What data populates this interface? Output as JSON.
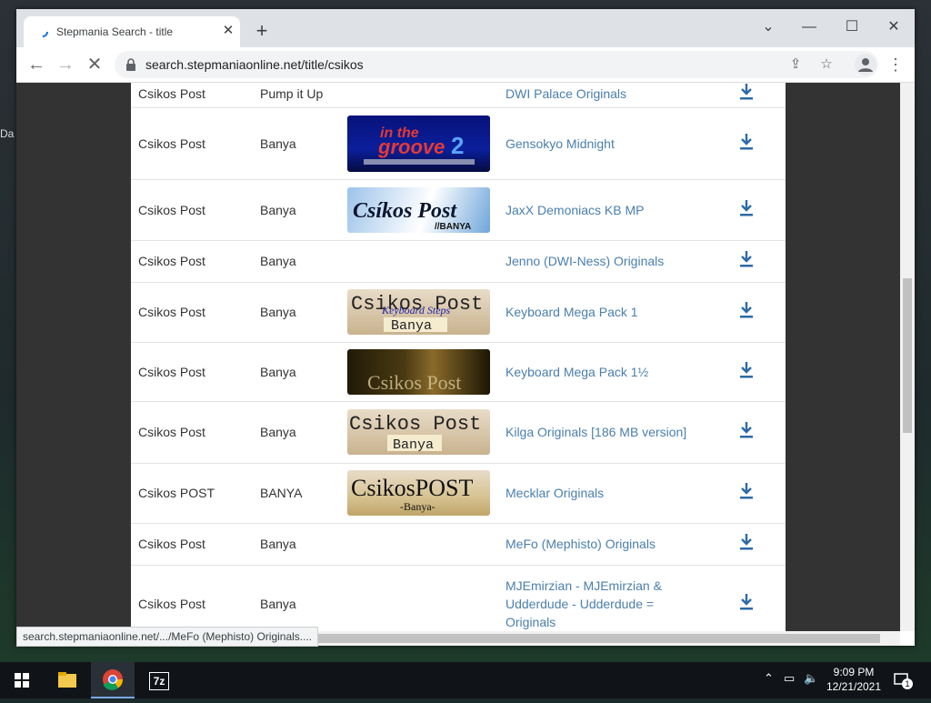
{
  "browser": {
    "tab_title": "Stepmania Search - title",
    "url": "search.stepmaniaonline.net/title/csikos",
    "status_url": "search.stepmaniaonline.net/.../MeFo (Mephisto) Originals...."
  },
  "results": [
    {
      "title": "Csikos Post",
      "artist": "Pump it Up",
      "pack": "DWI Palace Originals",
      "banner": ""
    },
    {
      "title": "Csikos Post",
      "artist": "Banya",
      "pack": "Gensokyo Midnight",
      "banner": "In the groove 2"
    },
    {
      "title": "Csikos Post",
      "artist": "Banya",
      "pack": "JaxX Demoniacs KB MP",
      "banner": "Csíkos Post BANYA"
    },
    {
      "title": "Csikos Post",
      "artist": "Banya",
      "pack": "Jenno (DWI-Ness) Originals",
      "banner": ""
    },
    {
      "title": "Csikos Post",
      "artist": "Banya",
      "pack": "Keyboard Mega Pack 1",
      "banner": "Csikos Post Keyboard Steps Banya"
    },
    {
      "title": "Csikos Post",
      "artist": "Banya",
      "pack": "Keyboard Mega Pack 1½",
      "banner": "Csikos Post"
    },
    {
      "title": "Csikos Post",
      "artist": "Banya",
      "pack": "Kilga Originals [186 MB version]",
      "banner": "Csikos Post Banya"
    },
    {
      "title": "Csikos POST",
      "artist": "BANYA",
      "pack": "Mecklar Originals",
      "banner": "CsikosPOST -Banya-"
    },
    {
      "title": "Csikos Post",
      "artist": "Banya",
      "pack": "MeFo (Mephisto) Originals",
      "banner": ""
    },
    {
      "title": "Csikos Post",
      "artist": "Banya",
      "pack": "MJEmirzian - MJEmirzian & Udderdude - Udderdude = Originals",
      "banner": ""
    }
  ],
  "taskbar": {
    "time": "9:09 PM",
    "date": "12/21/2021",
    "app_7z": "7z",
    "notification_count": "1"
  },
  "desktop": {
    "icon_label": "Da"
  },
  "colors": {
    "link": "#4a7fae",
    "download_icon": "#2c6aa8"
  }
}
